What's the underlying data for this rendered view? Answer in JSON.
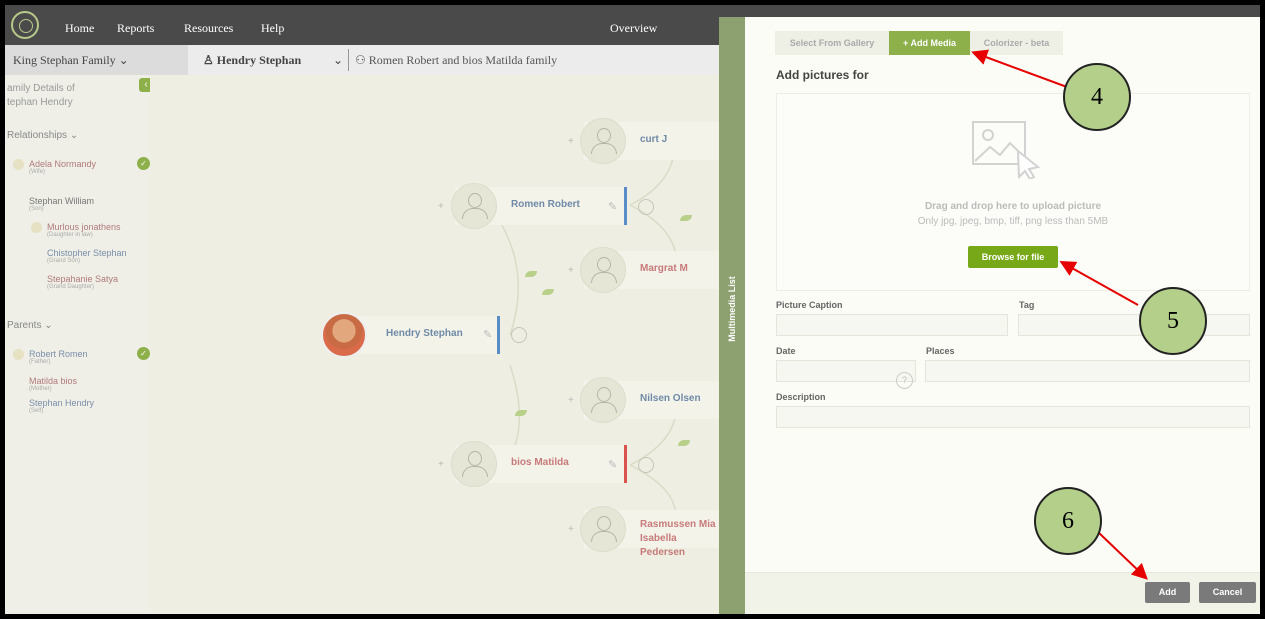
{
  "nav": {
    "items": [
      "Home",
      "Reports",
      "Resources",
      "Help"
    ],
    "overview": "Overview"
  },
  "subheader": {
    "family": "King Stephan Family",
    "person": "Hendry Stephan",
    "family_link": "Romen Robert and bios Matilda family"
  },
  "sidebar": {
    "title_line1": "amily Details of",
    "title_line2": "tephan Hendry",
    "relationships_label": "Relationships",
    "relationships": [
      {
        "name": "Adela Normandy",
        "role": "(Wife)"
      },
      {
        "name": "Stephan William",
        "role": "(Son)"
      },
      {
        "name": "Murlous jonathens",
        "role": "(Daughter in law)"
      },
      {
        "name": "Chistopher Stephan",
        "role": "(Grand Son)"
      },
      {
        "name": "Stepahanie Satya",
        "role": "(Grand Daughter)"
      }
    ],
    "parents_label": "Parents",
    "parents": [
      {
        "name": "Robert Romen",
        "role": "(Father)"
      },
      {
        "name": "Matilda bios",
        "role": "(Mother)"
      },
      {
        "name": "Stephan Hendry",
        "role": "(Self)"
      }
    ]
  },
  "tree": {
    "self": "Hendry Stephan",
    "father": "Romen Robert",
    "mother": "bios Matilda",
    "grandparents": [
      "curt J",
      "Margrat M",
      "Nilsen Olsen",
      "Rasmussen Mia",
      "Isabella Pedersen"
    ]
  },
  "panel": {
    "vertical_tab": "Multimedia List",
    "tabs": [
      "Select From Gallery",
      "+ Add Media",
      "Colorizer - beta"
    ],
    "title": "Add pictures for",
    "drop_main": "Drag and drop here to upload picture",
    "drop_sub": "Only jpg, jpeg, bmp, tiff, png less than 5MB",
    "browse": "Browse for file",
    "labels": {
      "caption": "Picture Caption",
      "tag": "Tag",
      "date": "Date",
      "places": "Places",
      "description": "Description"
    },
    "add": "Add",
    "cancel": "Cancel"
  },
  "callouts": [
    "4",
    "5",
    "6"
  ],
  "colors": {
    "accent": "#8db04b",
    "annotation_arrow": "#e60000",
    "callout_fill": "#b3cf8a"
  }
}
